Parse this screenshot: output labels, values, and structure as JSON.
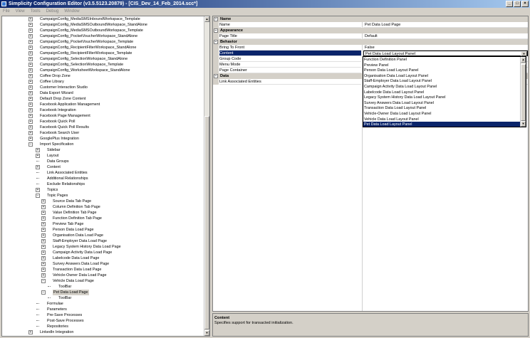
{
  "window": {
    "title": "Simplicity Configuration Editor (v3.5.5123.20879) - [CIS_Dev_14_Feb_2014.scc*]",
    "minimize": "_",
    "maximize": "□",
    "close": "×"
  },
  "menu": [
    "File",
    "View",
    "Tools",
    "Debug",
    "Window"
  ],
  "tree": {
    "rows": [
      {
        "label": "CampaignConfig_MediaSMSInboundWorkspace_Template",
        "depth": 0,
        "exp": "+"
      },
      {
        "label": "CampaignConfig_MediaSMSOutboundWorkspace_StandAlone",
        "depth": 0,
        "exp": "+"
      },
      {
        "label": "CampaignConfig_MediaSMSOutboundWorkspace_Template",
        "depth": 0,
        "exp": "+"
      },
      {
        "label": "CampaignConfig_PocketVoucherWorkspace_StandAlone",
        "depth": 0,
        "exp": "+"
      },
      {
        "label": "CampaignConfig_PocketVoucherWorkspace_Template",
        "depth": 0,
        "exp": "+"
      },
      {
        "label": "CampaignConfig_RecipientFilterWorkspace_StandAlone",
        "depth": 0,
        "exp": "+"
      },
      {
        "label": "CampaignConfig_RecipientFilterWorkspace_Template",
        "depth": 0,
        "exp": "+"
      },
      {
        "label": "CampaignConfig_SelectionWorkspace_StandAlone",
        "depth": 0,
        "exp": "+"
      },
      {
        "label": "CampaignConfig_SelectionWorkspace_Template",
        "depth": 0,
        "exp": "+"
      },
      {
        "label": "CampaignConfig_WorksheetWorkspace_StandAlone",
        "depth": 0,
        "exp": "+"
      },
      {
        "label": "Coffee Drop Zone",
        "depth": 0,
        "exp": "+"
      },
      {
        "label": "Coffee Library",
        "depth": 0,
        "exp": "+"
      },
      {
        "label": "Customer Interaction Studio",
        "depth": 0,
        "exp": "+"
      },
      {
        "label": "Data Export Wizard",
        "depth": 0,
        "exp": "+"
      },
      {
        "label": "Default Drop Zone Content",
        "depth": 0,
        "exp": "+"
      },
      {
        "label": "Facebook Application Management",
        "depth": 0,
        "exp": "+"
      },
      {
        "label": "Facebook Integration",
        "depth": 0,
        "exp": "+"
      },
      {
        "label": "Facebook Page Management",
        "depth": 0,
        "exp": "+"
      },
      {
        "label": "Facebook Quick Poll",
        "depth": 0,
        "exp": "+"
      },
      {
        "label": "Facebook Quick Poll Results",
        "depth": 0,
        "exp": "+"
      },
      {
        "label": "Facebook Search User",
        "depth": 0,
        "exp": "+"
      },
      {
        "label": "GooglePlus Integration",
        "depth": 0,
        "exp": "+"
      },
      {
        "label": "Import Specification",
        "depth": 0,
        "exp": "−"
      },
      {
        "label": "Sidebar",
        "depth": 1,
        "exp": "+"
      },
      {
        "label": "Layout",
        "depth": 1,
        "exp": "+"
      },
      {
        "label": "Data Groups",
        "depth": 1,
        "exp": ""
      },
      {
        "label": "Content",
        "depth": 1,
        "exp": "+"
      },
      {
        "label": "Link Associated Entities",
        "depth": 1,
        "exp": ""
      },
      {
        "label": "Additional Relationships",
        "depth": 1,
        "exp": ""
      },
      {
        "label": "Exclude Relationships",
        "depth": 1,
        "exp": ""
      },
      {
        "label": "Topics",
        "depth": 1,
        "exp": "+"
      },
      {
        "label": "Topic Pages",
        "depth": 1,
        "exp": "−"
      },
      {
        "label": "Source Data Tab Page",
        "depth": 2,
        "exp": "+"
      },
      {
        "label": "Column Definition Tab Page",
        "depth": 2,
        "exp": "+"
      },
      {
        "label": "Value Definition Tab Page",
        "depth": 2,
        "exp": "+"
      },
      {
        "label": "Function Definition Tab Page",
        "depth": 2,
        "exp": "+"
      },
      {
        "label": "Preview Tab Page",
        "depth": 2,
        "exp": "+"
      },
      {
        "label": "Person Data Load Page",
        "depth": 2,
        "exp": "+"
      },
      {
        "label": "Organisation Data Load Page",
        "depth": 2,
        "exp": "+"
      },
      {
        "label": "Staff-Employer Data Load Page",
        "depth": 2,
        "exp": "+"
      },
      {
        "label": "Legacy System History Data Load Page",
        "depth": 2,
        "exp": "+"
      },
      {
        "label": "Campaign Activity Data Load Page",
        "depth": 2,
        "exp": "+"
      },
      {
        "label": "Labelcode Data Load Page",
        "depth": 2,
        "exp": "+"
      },
      {
        "label": "Survey Answers Data Load Page",
        "depth": 2,
        "exp": "+"
      },
      {
        "label": "Transaction Data Load Page",
        "depth": 2,
        "exp": "+"
      },
      {
        "label": "Vehicle-Owner Data Load Page",
        "depth": 2,
        "exp": "+"
      },
      {
        "label": "Vehicle Data Load Page",
        "depth": 2,
        "exp": "−"
      },
      {
        "label": "ToolBar",
        "depth": 3,
        "exp": ""
      },
      {
        "label": "Pet Data Load Page",
        "depth": 2,
        "exp": "−",
        "selected": true
      },
      {
        "label": "ToolBar",
        "depth": 3,
        "exp": ""
      },
      {
        "label": "Formulae",
        "depth": 1,
        "exp": ""
      },
      {
        "label": "Parameters",
        "depth": 1,
        "exp": ""
      },
      {
        "label": "Pre-Save Processes",
        "depth": 1,
        "exp": ""
      },
      {
        "label": "Post-Save Processes",
        "depth": 1,
        "exp": ""
      },
      {
        "label": "Repositories",
        "depth": 1,
        "exp": ""
      },
      {
        "label": "LinkedIn Integration",
        "depth": 0,
        "exp": "+"
      }
    ]
  },
  "properties": {
    "rows": [
      {
        "type": "cat",
        "label": "Name"
      },
      {
        "type": "prop",
        "label": "Name",
        "value": "Pet Data Load Page"
      },
      {
        "type": "cat",
        "label": "Appearance"
      },
      {
        "type": "prop",
        "label": "Page Title",
        "value": "Default"
      },
      {
        "type": "cat",
        "label": "Behavior"
      },
      {
        "type": "prop",
        "label": "Bring To Front",
        "value": "False"
      },
      {
        "type": "prop",
        "label": "Content",
        "value": "Pet Data Load Layout Panel",
        "active": true
      },
      {
        "type": "prop",
        "label": "Group Code",
        "value": ""
      },
      {
        "type": "prop",
        "label": "Menu Mode",
        "value": ""
      },
      {
        "type": "prop",
        "label": "Page Container",
        "value": ""
      },
      {
        "type": "cat",
        "label": "Data"
      },
      {
        "type": "prop",
        "label": "Link Associated Entities",
        "value": ""
      }
    ],
    "cat_expander": "−",
    "dropdown_arrow": "▼"
  },
  "dropdown": {
    "items": [
      "Function Definition Panel",
      "Preview Panel",
      "Person Data Load Layout Panel",
      "Organisation Data Load Layout Panel",
      "Staff-Employer Data Load Layout Panel",
      "Campaign Activity Data Load Layout Panel",
      "Labelcode Data Load Layout Panel",
      "Legacy System History Data Load Layout Panel",
      "Survey Answers Data Load Layout Panel",
      "Transaction Data Load Layout Panel",
      "Vehicle-Owner Data Load Layout Panel",
      "Vehicle Data Load Layout Panel",
      "Pet Data Load Layout Panel"
    ],
    "selected_index": 12,
    "up_arrow": "▲",
    "down_arrow": "▼"
  },
  "description": {
    "title": "Content",
    "text": "Specifies support for transacted initialization."
  },
  "colors": {
    "selection": "#0a246a",
    "chrome": "#d4d0c8"
  }
}
